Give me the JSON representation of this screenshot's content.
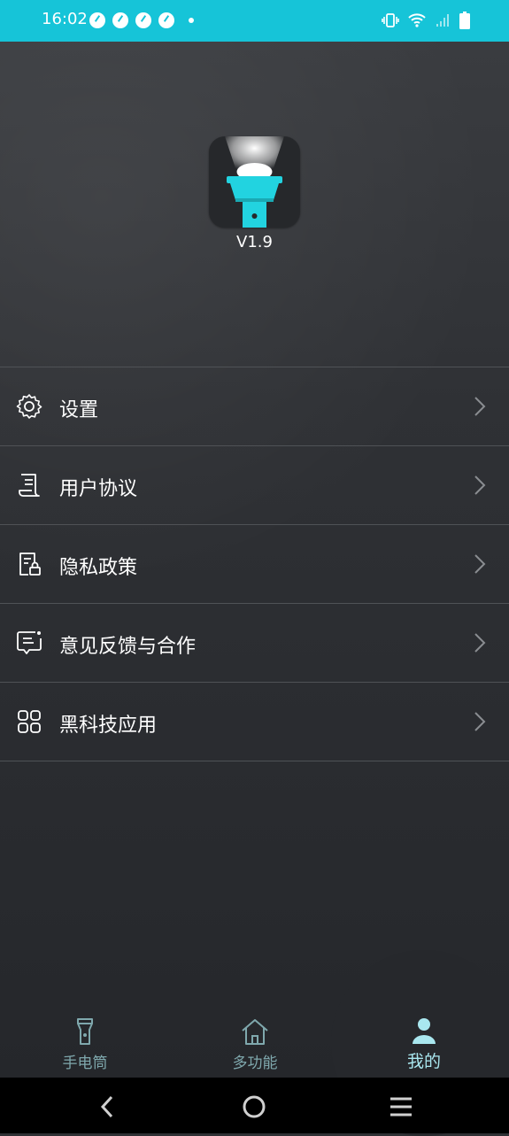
{
  "status_bar": {
    "time": "16:02",
    "bg_color": "#16c4d8"
  },
  "app": {
    "version": "V1.9",
    "logo_icon": "flashlight-icon"
  },
  "menu": [
    {
      "icon": "gear-icon",
      "label": "设置"
    },
    {
      "icon": "agreement-icon",
      "label": "用户协议"
    },
    {
      "icon": "privacy-lock-icon",
      "label": "隐私政策"
    },
    {
      "icon": "feedback-icon",
      "label": "意见反馈与合作"
    },
    {
      "icon": "apps-grid-icon",
      "label": "黑科技应用"
    }
  ],
  "tabs": [
    {
      "icon": "flashlight-icon",
      "label": "手电筒",
      "active": false
    },
    {
      "icon": "home-icon",
      "label": "多功能",
      "active": false
    },
    {
      "icon": "user-icon",
      "label": "我的",
      "active": true
    }
  ],
  "colors": {
    "accent": "#a9e7ef",
    "tab_inactive": "#7fa8ad",
    "logo_teal": "#22d3e0"
  }
}
